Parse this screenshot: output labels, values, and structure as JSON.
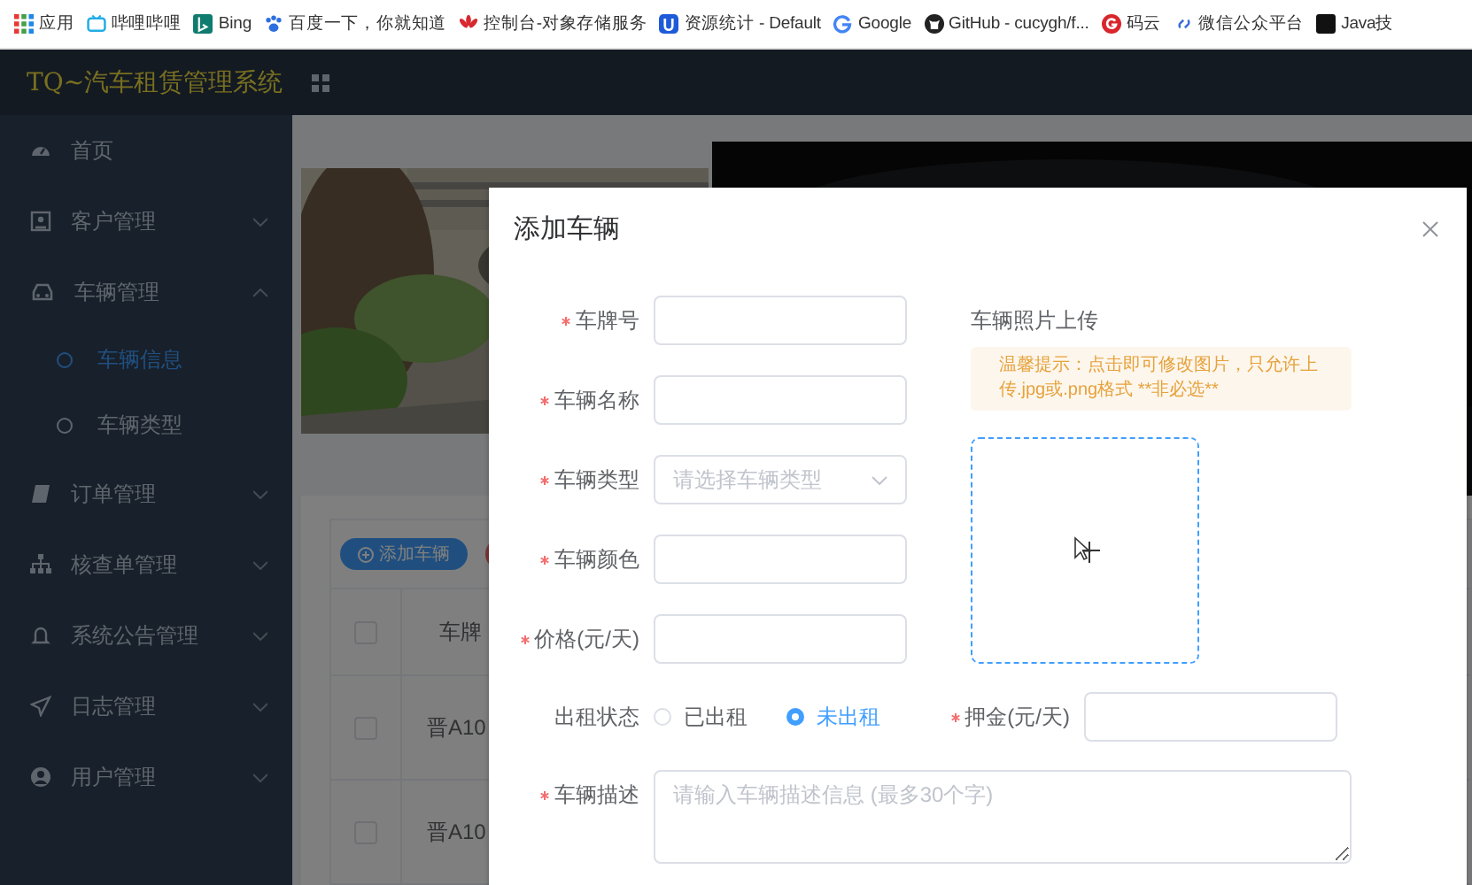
{
  "bookmarks": [
    {
      "label": "应用"
    },
    {
      "label": "哔哩哔哩"
    },
    {
      "label": "Bing"
    },
    {
      "label": "百度一下，你就知道"
    },
    {
      "label": "控制台-对象存储服务"
    },
    {
      "label": "资源统计 - Default"
    },
    {
      "label": "Google"
    },
    {
      "label": "GitHub - cucygh/f..."
    },
    {
      "label": "码云"
    },
    {
      "label": "微信公众平台"
    },
    {
      "label": "Java技"
    }
  ],
  "header": {
    "title": "TQ~汽车租赁管理系统"
  },
  "sidebar": {
    "items": [
      {
        "label": "首页",
        "selected": false
      },
      {
        "label": "客户管理",
        "selected": false,
        "expanded": false
      },
      {
        "label": "车辆管理",
        "selected": false,
        "expanded": true,
        "children": [
          {
            "label": "车辆信息",
            "selected": true
          },
          {
            "label": "车辆类型",
            "selected": false
          }
        ]
      },
      {
        "label": "订单管理",
        "selected": false,
        "expanded": false
      },
      {
        "label": "核查单管理",
        "selected": false,
        "expanded": false
      },
      {
        "label": "系统公告管理",
        "selected": false,
        "expanded": false
      },
      {
        "label": "日志管理",
        "selected": false,
        "expanded": false
      },
      {
        "label": "用户管理",
        "selected": false,
        "expanded": false
      }
    ]
  },
  "toolbar": {
    "buttons": [
      {
        "label": "添加车辆",
        "kind": "primary"
      },
      {
        "kind": "danger"
      }
    ]
  },
  "table": {
    "columns": [
      {
        "kind": "checkbox",
        "checked": false
      },
      {
        "label": "车牌"
      }
    ],
    "rows": [
      {
        "checked": false,
        "cells": [
          "晋A10"
        ]
      },
      {
        "checked": false,
        "cells": [
          "晋A10"
        ]
      }
    ]
  },
  "dialog": {
    "title": "添加车辆",
    "fields": [
      {
        "label": "车牌号",
        "required": true,
        "kind": "input"
      },
      {
        "label": "车辆名称",
        "required": true,
        "kind": "input"
      },
      {
        "label": "车辆类型",
        "required": true,
        "kind": "select",
        "placeholder": "请选择车辆类型"
      },
      {
        "label": "车辆颜色",
        "required": true,
        "kind": "input"
      },
      {
        "label": "价格(元/天)",
        "required": true,
        "kind": "input"
      }
    ],
    "status": {
      "label": "出租状态",
      "options": [
        {
          "label": "已出租",
          "selected": false
        },
        {
          "label": "未出租",
          "selected": true
        }
      ]
    },
    "deposit": {
      "label": "押金(元/天)",
      "required": true
    },
    "description": {
      "label": "车辆描述",
      "required": true,
      "placeholder": "请输入车辆描述信息 (最多30个字)"
    },
    "upload": {
      "label": "车辆照片上传",
      "tip": "温馨提示：点击即可修改图片，只允许上传.jpg或.png格式 **非必选**"
    }
  }
}
